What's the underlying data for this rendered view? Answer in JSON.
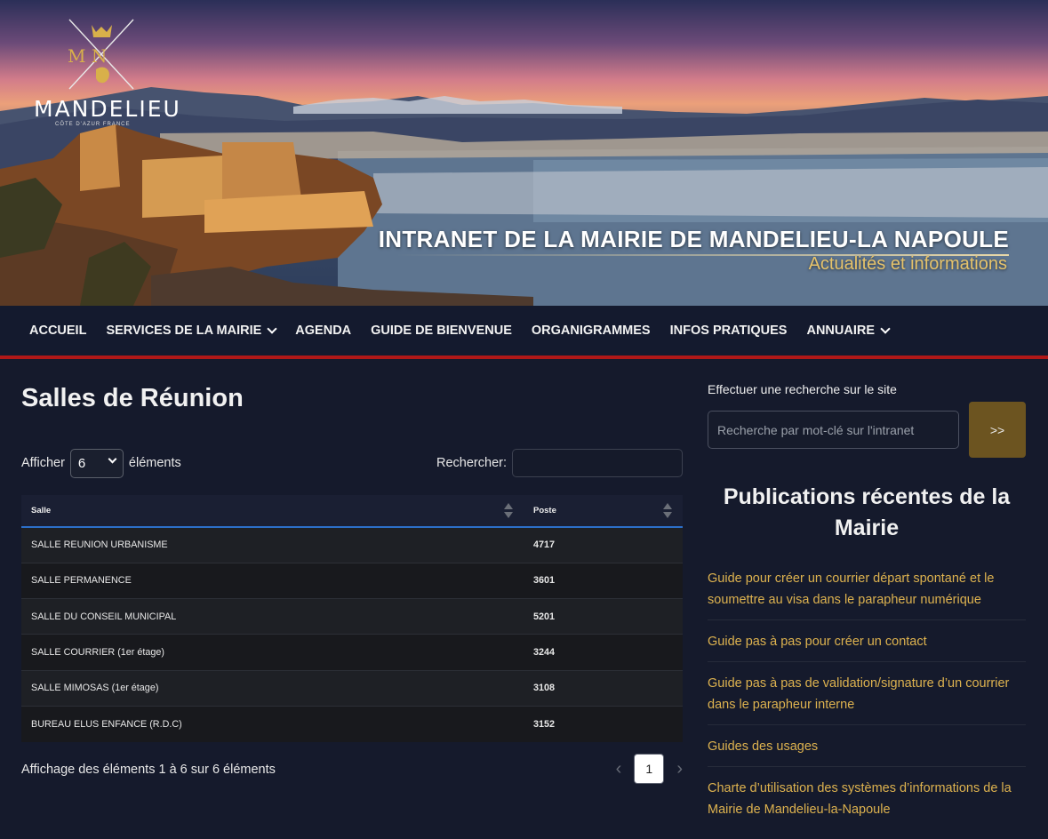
{
  "banner": {
    "logo_letters": "M N",
    "logo_word": "MANDELIEU",
    "logo_sub": "CÔTE D'AZUR FRANCE",
    "title": "INTRANET DE LA MAIRIE DE MANDELIEU-LA NAPOULE",
    "subtitle": "Actualités et informations"
  },
  "nav": {
    "items": [
      {
        "label": "ACCUEIL",
        "dropdown": false
      },
      {
        "label": "SERVICES DE LA MAIRIE",
        "dropdown": true
      },
      {
        "label": "AGENDA",
        "dropdown": false
      },
      {
        "label": "GUIDE DE BIENVENUE",
        "dropdown": false
      },
      {
        "label": "ORGANIGRAMMES",
        "dropdown": false
      },
      {
        "label": "INFOS PRATIQUES",
        "dropdown": false
      },
      {
        "label": "ANNUAIRE",
        "dropdown": true
      }
    ]
  },
  "main": {
    "title": "Salles de Réunion",
    "show_prefix": "Afficher",
    "show_value": "6",
    "show_suffix": "éléments",
    "search_label": "Rechercher:",
    "table": {
      "headers": [
        "Salle",
        "Poste"
      ],
      "rows": [
        [
          "SALLE REUNION URBANISME",
          "4717"
        ],
        [
          "SALLE PERMANENCE",
          "3601"
        ],
        [
          "SALLE DU CONSEIL MUNICIPAL",
          "5201"
        ],
        [
          "SALLE COURRIER (1er étage)",
          "3244"
        ],
        [
          "SALLE MIMOSAS (1er étage)",
          "3108"
        ],
        [
          "BUREAU ELUS ENFANCE (R.D.C)",
          "3152"
        ]
      ]
    },
    "info": "Affichage des éléments 1 à 6 sur 6 éléments",
    "pager": {
      "prev": "‹",
      "page": "1",
      "next": "›"
    }
  },
  "sidebar": {
    "search_label": "Effectuer une recherche sur le site",
    "search_placeholder": "Recherche par mot-clé sur l'intranet",
    "search_button": ">>",
    "heading": "Publications récentes de la Mairie",
    "publications": [
      "Guide pour créer un courrier départ spontané et le soumettre au visa dans le parapheur numérique",
      "Guide pas à pas pour créer un contact",
      "Guide pas à pas de validation/signature d’un courrier dans le parapheur interne",
      "Guides des usages",
      "Charte d’utilisation des systèmes d’informations de la Mairie de Mandelieu-la-Napoule"
    ]
  },
  "colors": {
    "background": "#151a2c",
    "nav_border": "#b01818",
    "accent_gold": "#ddb24f",
    "button_gold": "#6c5420",
    "table_header_border": "#2c6fc9"
  }
}
